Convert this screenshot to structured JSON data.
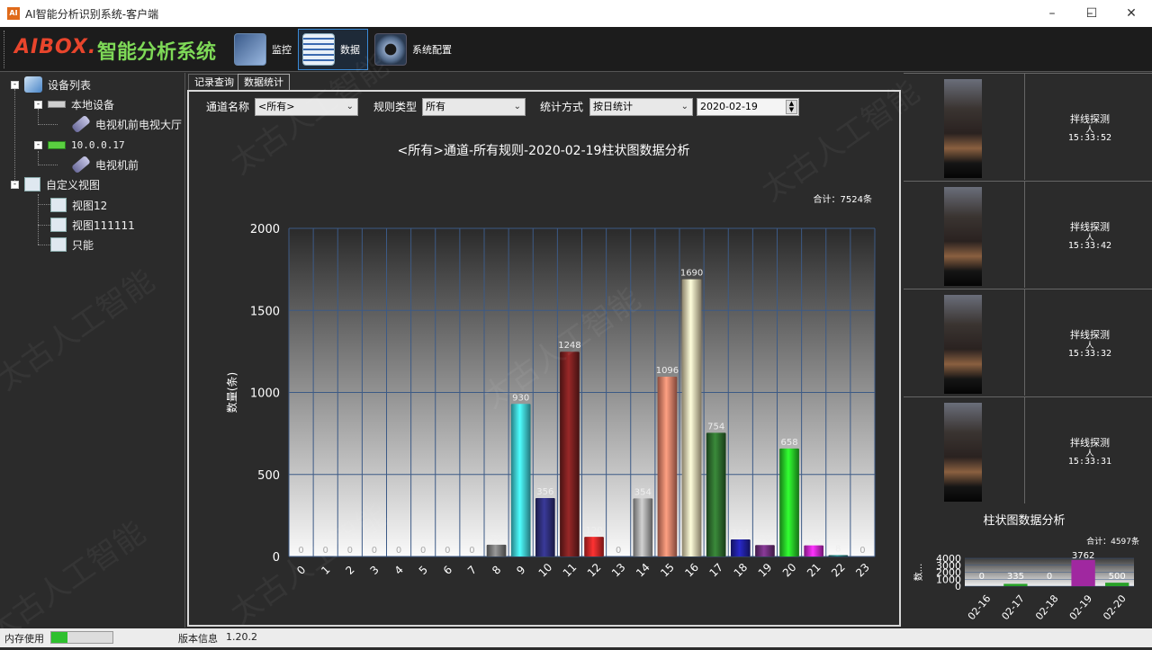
{
  "window": {
    "title": "AI智能分析识别系统-客户端",
    "minimize": "–",
    "maximize": "☐",
    "close": "✕"
  },
  "toolbar": {
    "brand": "AIBOX.",
    "brand_title": "智能分析系统",
    "monitor_label": "监控",
    "data_label": "数据",
    "config_label": "系统配置"
  },
  "tree": {
    "root": "设备列表",
    "local": "本地设备",
    "local_cam": "电视机前电视大厅",
    "ip": "10.0.0.17",
    "ip_cam": "电视机前",
    "custom": "自定义视图",
    "view1": "视图12",
    "view2": "视图111111",
    "view3": "只能"
  },
  "tabs": {
    "records": "记录查询",
    "stats": "数据统计"
  },
  "filters": {
    "channel_label": "通道名称",
    "channel_value": "<所有>",
    "rule_label": "规则类型",
    "rule_value": "所有",
    "method_label": "统计方式",
    "method_value": "按日统计",
    "date_value": "2020-02-19"
  },
  "chart_data": [
    {
      "type": "bar",
      "title": "<所有>通道-所有规则-2020-02-19柱状图数据分析",
      "total": "合计：7524条",
      "ylabel": "数量(条)",
      "ylim": [
        0,
        2000
      ],
      "yticks": [
        "0",
        "500",
        "1000",
        "1500",
        "2000"
      ],
      "categories": [
        "0",
        "1",
        "2",
        "3",
        "4",
        "5",
        "6",
        "7",
        "8",
        "9",
        "10",
        "11",
        "12",
        "13",
        "14",
        "15",
        "16",
        "17",
        "18",
        "19",
        "20",
        "21",
        "22",
        "23"
      ],
      "values": [
        0,
        0,
        0,
        0,
        0,
        0,
        0,
        0,
        72,
        930,
        356,
        1248,
        120,
        0,
        354,
        1096,
        1690,
        754,
        104,
        70,
        658,
        68,
        8,
        0
      ],
      "colors": [
        "#888",
        "#888",
        "#888",
        "#888",
        "#888",
        "#888",
        "#888",
        "#888",
        "#7a7a7a",
        "#3fd6e0",
        "#2e2e7a",
        "#7a2020",
        "#d82828",
        "#888",
        "#a8a8a8",
        "#e88068",
        "#e8d8b0",
        "#2e6e2e",
        "#2020a0",
        "#6e2e7a",
        "#28d028",
        "#d028d0",
        "#1a7070",
        "#888"
      ]
    },
    {
      "type": "bar",
      "title": "柱状图数据分析",
      "total": "合计：4597条",
      "ylabel": "数...",
      "ylim": [
        0,
        4000
      ],
      "yticks": [
        "0",
        "1000",
        "2000",
        "3000",
        "4000"
      ],
      "categories": [
        "02-16",
        "02-17",
        "02-18",
        "02-19",
        "02-20"
      ],
      "values": [
        0,
        335,
        0,
        3762,
        500
      ],
      "colors": [
        "#888",
        "#28a028",
        "#888",
        "#a028a0",
        "#28a028"
      ]
    }
  ],
  "alarms": [
    {
      "type": "拌线探测",
      "sub": "人",
      "time": "15:33:52"
    },
    {
      "type": "拌线探测",
      "sub": "人",
      "time": "15:33:42"
    },
    {
      "type": "拌线探测",
      "sub": "人",
      "time": "15:33:32"
    },
    {
      "type": "拌线探测",
      "sub": "人",
      "time": "15:33:31"
    }
  ],
  "status": {
    "memory_label": "内存使用",
    "memory_fraction": 0.27,
    "version_label": "版本信息",
    "version": "1.20.2"
  },
  "watermark": "太古人工智能"
}
